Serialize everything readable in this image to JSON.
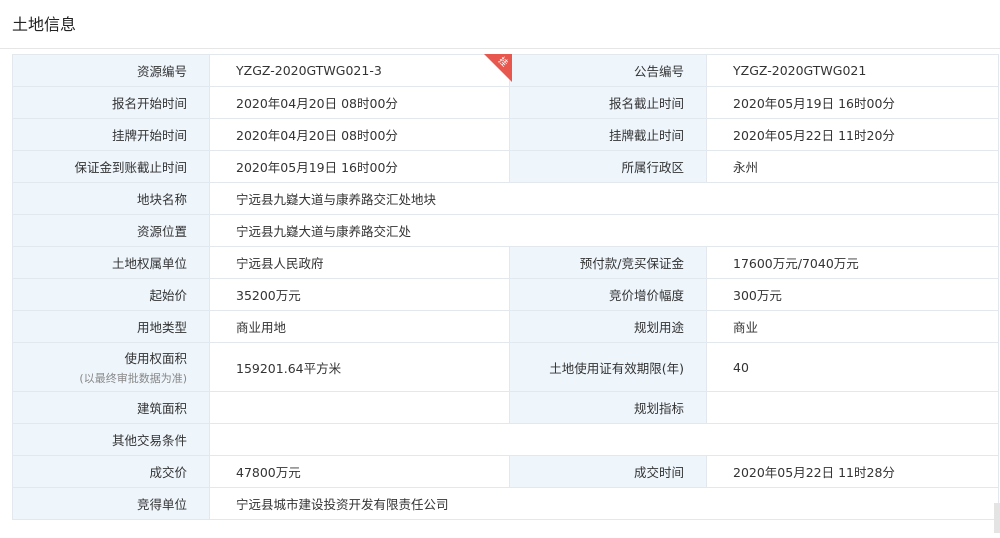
{
  "page": {
    "title": "土地信息"
  },
  "corner_badge": "挂",
  "rows": [
    {
      "l1": "资源编号",
      "v1": "YZGZ-2020GTWG021-3",
      "l2": "公告编号",
      "v2": "YZGZ-2020GTWG021"
    },
    {
      "l1": "报名开始时间",
      "v1": "2020年04月20日 08时00分",
      "l2": "报名截止时间",
      "v2": "2020年05月19日 16时00分"
    },
    {
      "l1": "挂牌开始时间",
      "v1": "2020年04月20日 08时00分",
      "l2": "挂牌截止时间",
      "v2": "2020年05月22日 11时20分"
    },
    {
      "l1": "保证金到账截止时间",
      "v1": "2020年05月19日 16时00分",
      "l2": "所属行政区",
      "v2": "永州"
    },
    {
      "l1": "地块名称",
      "v1": "宁远县九嶷大道与康养路交汇处地块"
    },
    {
      "l1": "资源位置",
      "v1": "宁远县九嶷大道与康养路交汇处"
    },
    {
      "l1": "土地权属单位",
      "v1": "宁远县人民政府",
      "l2": "预付款/竞买保证金",
      "v2": "17600万元/7040万元"
    },
    {
      "l1": "起始价",
      "v1": "35200万元",
      "l2": "竞价增价幅度",
      "v2": "300万元"
    },
    {
      "l1": "用地类型",
      "v1": "商业用地",
      "l2": "规划用途",
      "v2": "商业"
    },
    {
      "l1": "使用权面积",
      "l1_sub": "(以最终审批数据为准)",
      "v1": "159201.64平方米",
      "l2": "土地使用证有效期限(年)",
      "v2": "40"
    },
    {
      "l1": "建筑面积",
      "v1": "",
      "l2": "规划指标",
      "v2": ""
    },
    {
      "l1": "其他交易条件",
      "v1": ""
    },
    {
      "l1": "成交价",
      "v1": "47800万元",
      "l2": "成交时间",
      "v2": "2020年05月22日 11时28分"
    },
    {
      "l1": "竞得单位",
      "v1": "宁远县城市建设投资开发有限责任公司"
    }
  ]
}
